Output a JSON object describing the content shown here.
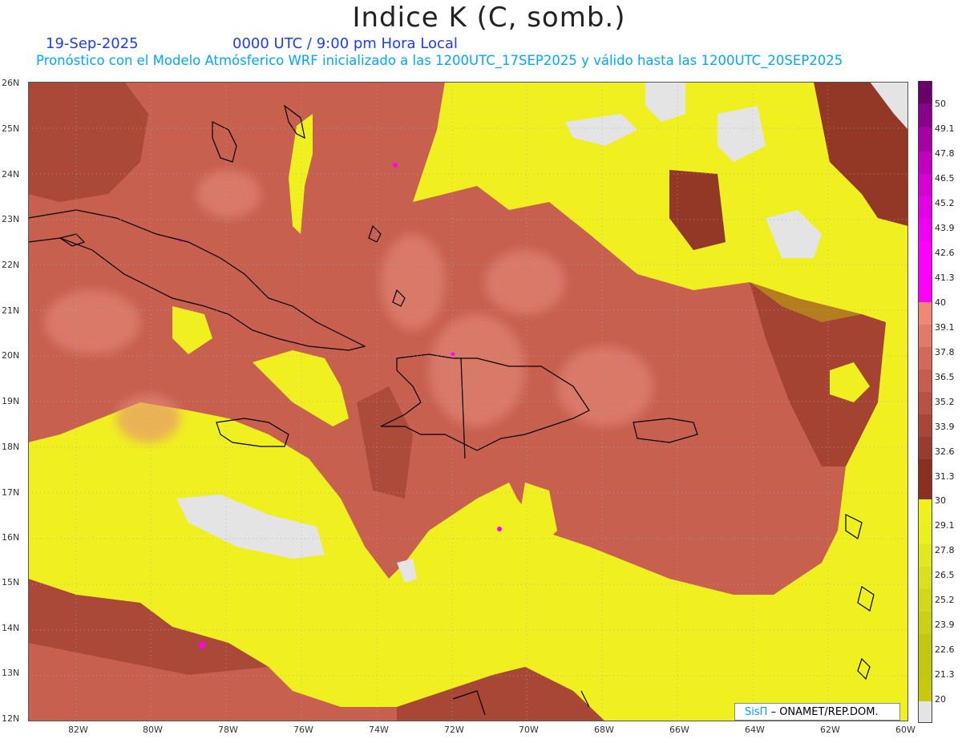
{
  "header": {
    "title": "Indice K (C, somb.)",
    "date": "19-Sep-2025",
    "time": "0000 UTC / 9:00 pm Hora Local",
    "subtitle": "Pronóstico con el Modelo Atmósferico WRF inicializado a las 1200UTC_17SEP2025 y válido hasta las  1200UTC_20SEP2025"
  },
  "map": {
    "lat_labels": [
      "26N",
      "25N",
      "24N",
      "23N",
      "22N",
      "21N",
      "20N",
      "19N",
      "18N",
      "17N",
      "16N",
      "15N",
      "14N",
      "13N",
      "12N"
    ],
    "lon_labels": [
      "82W",
      "80W",
      "78W",
      "76W",
      "74W",
      "72W",
      "70W",
      "68W",
      "66W",
      "64W",
      "62W",
      "60W"
    ]
  },
  "colorbar": {
    "levels": [
      "50",
      "49.1",
      "47.8",
      "46.5",
      "45.2",
      "43.9",
      "42.6",
      "41.3",
      "40",
      "39.1",
      "37.8",
      "36.5",
      "35.2",
      "33.9",
      "32.6",
      "31.3",
      "30",
      "29.1",
      "27.8",
      "26.5",
      "25.2",
      "23.9",
      "22.6",
      "21.3",
      "20"
    ],
    "colors": {
      "c1": "#6a006a",
      "c2": "#8a008a",
      "c3": "#a800a8",
      "c4": "#c000c0",
      "c5": "#d400d4",
      "c6": "#e400e4",
      "c7": "#f000f0",
      "c8": "#ff00ff",
      "c9": "#f08878",
      "c10": "#e07a6a",
      "c11": "#d26a5c",
      "c12": "#c65e50",
      "c13": "#b85244",
      "c14": "#a8463a",
      "c15": "#983c30",
      "c16": "#8a3020",
      "c17": "#f0f020",
      "c18": "#eaf020",
      "c19": "#e0e820",
      "c20": "#d8e020",
      "c21": "#d0d81c",
      "c22": "#c8d018",
      "c23": "#c0c814",
      "c24": "#e4e4e4"
    }
  },
  "credit": {
    "brand": "SisΠ",
    "text": "– ONAMET/REP.DOM."
  }
}
